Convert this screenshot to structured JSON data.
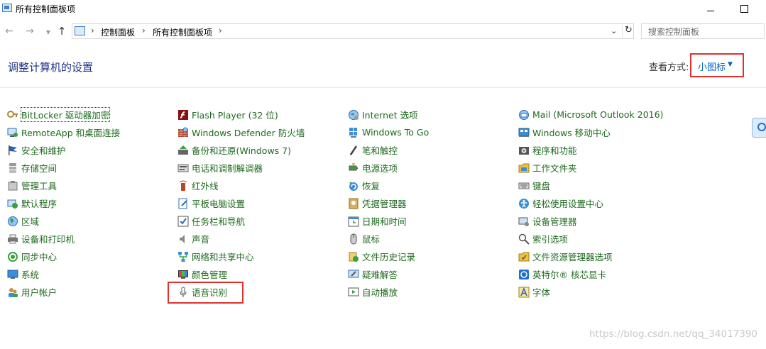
{
  "window": {
    "title": "所有控制面板项",
    "minimize_icon": "minimize-icon",
    "maximize_icon": "maximize-icon"
  },
  "nav": {
    "breadcrumbs": [
      "控制面板",
      "所有控制面板项"
    ],
    "search_placeholder": "搜索控制面板"
  },
  "header": {
    "title": "调整计算机的设置",
    "view_by_label": "查看方式:",
    "view_by_value": "小图标"
  },
  "columns": [
    {
      "items": [
        {
          "label": "BitLocker 驱动器加密",
          "icon": "bitlocker-icon"
        },
        {
          "label": "RemoteApp 和桌面连接",
          "icon": "remoteapp-icon"
        },
        {
          "label": "安全和维护",
          "icon": "flag-icon"
        },
        {
          "label": "存储空间",
          "icon": "storage-icon"
        },
        {
          "label": "管理工具",
          "icon": "admin-tools-icon"
        },
        {
          "label": "默认程序",
          "icon": "default-programs-icon"
        },
        {
          "label": "区域",
          "icon": "region-icon"
        },
        {
          "label": "设备和打印机",
          "icon": "printer-icon"
        },
        {
          "label": "同步中心",
          "icon": "sync-icon"
        },
        {
          "label": "系统",
          "icon": "system-icon"
        },
        {
          "label": "用户帐户",
          "icon": "user-accounts-icon"
        }
      ]
    },
    {
      "items": [
        {
          "label": "Flash Player (32 位)",
          "icon": "flash-icon"
        },
        {
          "label": "Windows Defender 防火墙",
          "icon": "firewall-icon"
        },
        {
          "label": "备份和还原(Windows 7)",
          "icon": "backup-icon"
        },
        {
          "label": "电话和调制解调器",
          "icon": "phone-modem-icon"
        },
        {
          "label": "红外线",
          "icon": "infrared-icon"
        },
        {
          "label": "平板电脑设置",
          "icon": "tablet-icon"
        },
        {
          "label": "任务栏和导航",
          "icon": "taskbar-icon"
        },
        {
          "label": "声音",
          "icon": "sound-icon"
        },
        {
          "label": "网络和共享中心",
          "icon": "network-icon"
        },
        {
          "label": "颜色管理",
          "icon": "color-management-icon"
        },
        {
          "label": "语音识别",
          "icon": "microphone-icon"
        }
      ]
    },
    {
      "items": [
        {
          "label": "Internet 选项",
          "icon": "internet-options-icon"
        },
        {
          "label": "Windows To Go",
          "icon": "windows-to-go-icon"
        },
        {
          "label": "笔和触控",
          "icon": "pen-icon"
        },
        {
          "label": "电源选项",
          "icon": "power-icon"
        },
        {
          "label": "恢复",
          "icon": "recovery-icon"
        },
        {
          "label": "凭据管理器",
          "icon": "credential-icon"
        },
        {
          "label": "日期和时间",
          "icon": "clock-icon"
        },
        {
          "label": "鼠标",
          "icon": "mouse-icon"
        },
        {
          "label": "文件历史记录",
          "icon": "file-history-icon"
        },
        {
          "label": "疑难解答",
          "icon": "troubleshoot-icon"
        },
        {
          "label": "自动播放",
          "icon": "autoplay-icon"
        }
      ]
    },
    {
      "items": [
        {
          "label": "Mail (Microsoft Outlook 2016)",
          "icon": "mail-icon"
        },
        {
          "label": "Windows 移动中心",
          "icon": "mobility-center-icon"
        },
        {
          "label": "程序和功能",
          "icon": "programs-icon"
        },
        {
          "label": "工作文件夹",
          "icon": "work-folders-icon"
        },
        {
          "label": "键盘",
          "icon": "keyboard-icon"
        },
        {
          "label": "轻松使用设置中心",
          "icon": "ease-of-access-icon"
        },
        {
          "label": "设备管理器",
          "icon": "device-manager-icon"
        },
        {
          "label": "索引选项",
          "icon": "indexing-icon"
        },
        {
          "label": "文件资源管理器选项",
          "icon": "explorer-options-icon"
        },
        {
          "label": "英特尔® 核芯显卡",
          "icon": "intel-graphics-icon"
        },
        {
          "label": "字体",
          "icon": "fonts-icon"
        }
      ]
    }
  ],
  "watermark": "https://blog.csdn.net/qq_34017390"
}
